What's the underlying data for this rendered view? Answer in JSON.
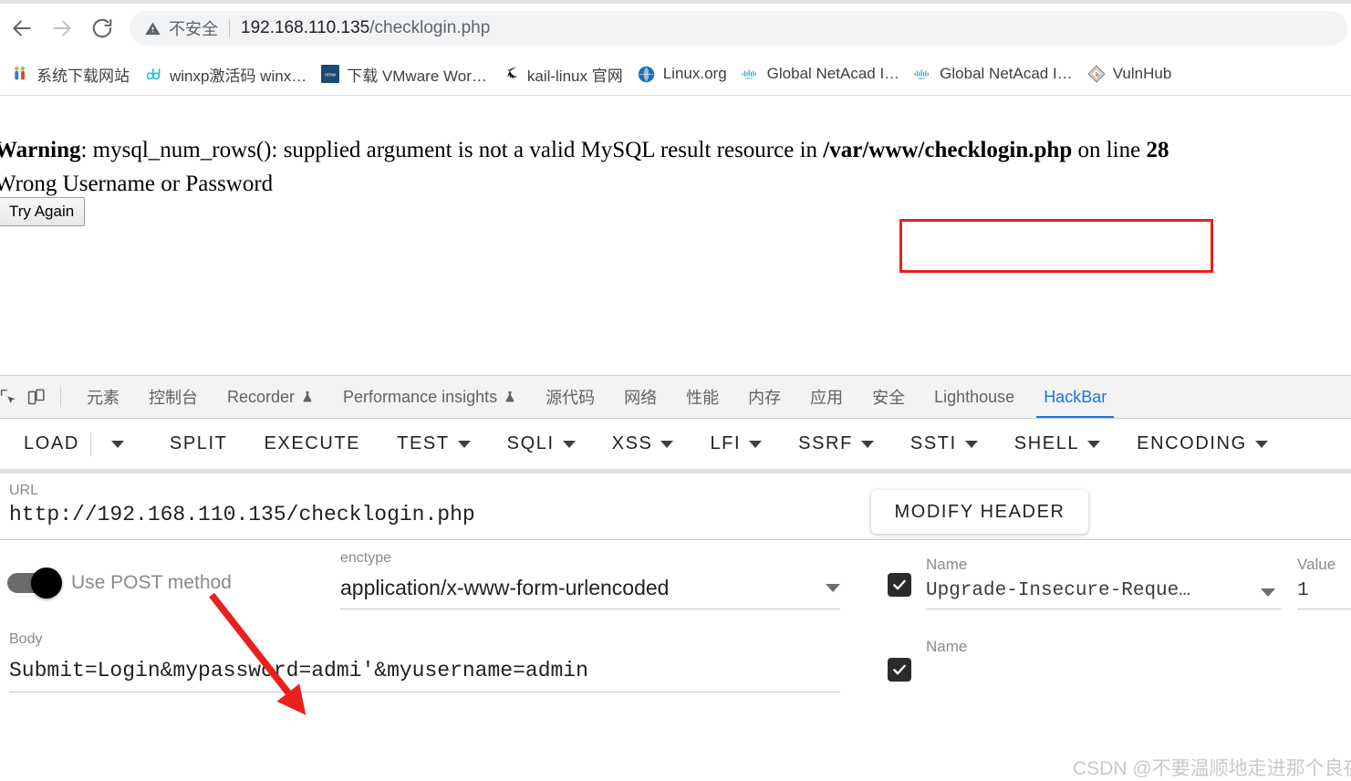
{
  "browser": {
    "nav": {
      "back_title": "Back",
      "forward_title": "Forward",
      "reload_title": "Reload"
    },
    "omnibox": {
      "security_warning": "不安全",
      "url_host": "192.168.110.135",
      "url_path": "/checklogin.php"
    },
    "bookmarks": [
      {
        "label": "系统下载网站",
        "icon": "download-site-icon"
      },
      {
        "label": "winxp激活码 winx…",
        "icon": "dd-icon"
      },
      {
        "label": "下载 VMware Wor…",
        "icon": "vmware-icon"
      },
      {
        "label": "kail-linux 官网",
        "icon": "kali-dragon-icon"
      },
      {
        "label": "Linux.org",
        "icon": "linux-globe-icon"
      },
      {
        "label": "Global NetAcad I…",
        "icon": "cisco-icon"
      },
      {
        "label": "Global NetAcad I…",
        "icon": "cisco-icon"
      },
      {
        "label": "VulnHub",
        "icon": "vulnhub-icon"
      }
    ]
  },
  "page": {
    "warning_prefix": "Warning",
    "warning_body": ": mysql_num_rows(): supplied argument is not a valid MySQL result resource in ",
    "warning_file": "/var/www/checklogin.php",
    "warning_suffix": " on line ",
    "warning_line_number": "28",
    "error_message": "Wrong Username or Password",
    "try_again_label": "Try Again",
    "annotation_color": "#e8201f"
  },
  "devtools": {
    "inspect_icon": "inspect-element-icon",
    "device_icon": "device-toolbar-icon",
    "tabs": [
      {
        "label": "元素",
        "active": false,
        "flask": false
      },
      {
        "label": "控制台",
        "active": false,
        "flask": false
      },
      {
        "label": "Recorder",
        "active": false,
        "flask": true
      },
      {
        "label": "Performance insights",
        "active": false,
        "flask": true
      },
      {
        "label": "源代码",
        "active": false,
        "flask": false
      },
      {
        "label": "网络",
        "active": false,
        "flask": false
      },
      {
        "label": "性能",
        "active": false,
        "flask": false
      },
      {
        "label": "内存",
        "active": false,
        "flask": false
      },
      {
        "label": "应用",
        "active": false,
        "flask": false
      },
      {
        "label": "安全",
        "active": false,
        "flask": false
      },
      {
        "label": "Lighthouse",
        "active": false,
        "flask": false
      },
      {
        "label": "HackBar",
        "active": true,
        "flask": false
      }
    ],
    "active_tab_accent": "#1a73e8"
  },
  "hackbar": {
    "toolbar": [
      {
        "label": "LOAD",
        "caret": false,
        "separate_caret": true
      },
      {
        "label": "SPLIT",
        "caret": false
      },
      {
        "label": "EXECUTE",
        "caret": false
      },
      {
        "label": "TEST",
        "caret": true
      },
      {
        "label": "SQLI",
        "caret": true
      },
      {
        "label": "XSS",
        "caret": true
      },
      {
        "label": "LFI",
        "caret": true
      },
      {
        "label": "SSRF",
        "caret": true
      },
      {
        "label": "SSTI",
        "caret": true
      },
      {
        "label": "SHELL",
        "caret": true
      },
      {
        "label": "ENCODING",
        "caret": true
      }
    ],
    "url_field": {
      "label": "URL",
      "value": "http://192.168.110.135/checklogin.php"
    },
    "post_toggle": {
      "label": "Use POST method",
      "enabled": true
    },
    "enctype_field": {
      "label": "enctype",
      "value": "application/x-www-form-urlencoded"
    },
    "body_field": {
      "label": "Body",
      "value": "Submit=Login&mypassword=admi'&myusername=admin"
    },
    "modify_header": {
      "button_label": "MODIFY HEADER",
      "columns": {
        "name": "Name",
        "value": "Value"
      },
      "rows": [
        {
          "checked": true,
          "name": "Upgrade-Insecure-Reque…",
          "value": "1"
        },
        {
          "checked": true,
          "name": "",
          "value": ""
        }
      ]
    }
  },
  "watermark": "CSDN @不要温顺地走进那个良夜"
}
